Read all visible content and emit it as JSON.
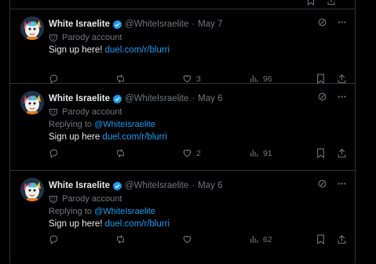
{
  "colors": {
    "background": "#000000",
    "text": "#e7e9ea",
    "muted": "#71767b",
    "link": "#1d9bf0",
    "verified": "#1d9bf0",
    "divider": "#2f3336"
  },
  "tweets": [
    {
      "name": "White Israelite",
      "handle": "@WhiteIsraelite",
      "separator": "·",
      "date": "May 7",
      "parody_label": "Parody account",
      "reply_prefix": "",
      "reply_handle": "",
      "text": "Sign up here! ",
      "link": "duel.com/r/blurri",
      "likes": "3",
      "views": "96",
      "icons": [
        "grok-icon",
        "more-icon",
        "reply-icon",
        "retweet-icon",
        "like-icon",
        "views-icon",
        "bookmark-icon",
        "share-icon"
      ]
    },
    {
      "name": "White Israelite",
      "handle": "@WhiteIsraelite",
      "separator": "·",
      "date": "May 6",
      "parody_label": "Parody account",
      "reply_prefix": "Replying to ",
      "reply_handle": "@WhiteIsraelite",
      "text": "Sign up here ",
      "link": "duel.com/r/blurri",
      "likes": "2",
      "views": "91"
    },
    {
      "name": "White Israelite",
      "handle": "@WhiteIsraelite",
      "separator": "·",
      "date": "May 6",
      "parody_label": "Parody account",
      "reply_prefix": "Replying to ",
      "reply_handle": "@WhiteIsraelite",
      "text": "Sign up here! ",
      "link": "duel.com/r/blurri",
      "likes": "",
      "views": "62"
    }
  ]
}
